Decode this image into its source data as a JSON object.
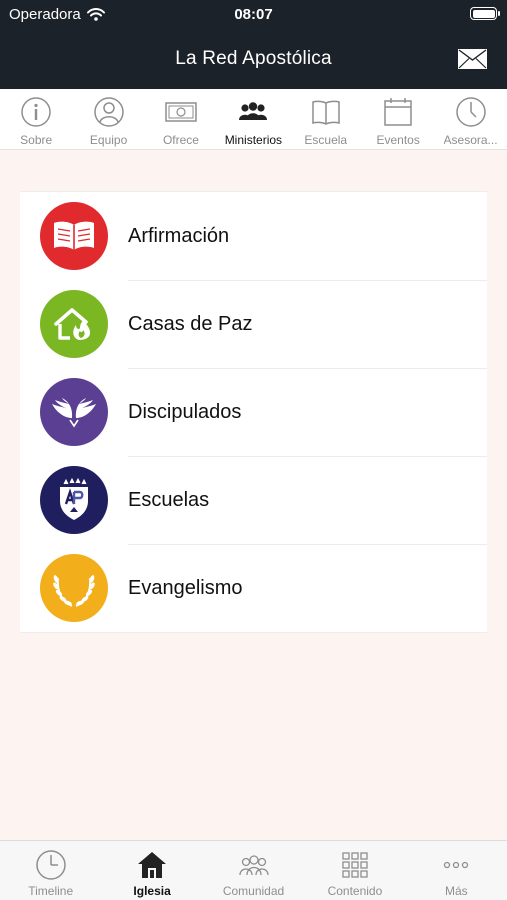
{
  "status_bar": {
    "carrier": "Operadora",
    "time": "08:07"
  },
  "header": {
    "title": "La Red Apostólica"
  },
  "top_tabs": [
    {
      "label": "Sobre",
      "icon": "info-icon"
    },
    {
      "label": "Equipo",
      "icon": "person-icon"
    },
    {
      "label": "Ofrece",
      "icon": "money-icon"
    },
    {
      "label": "Ministerios",
      "icon": "group-icon",
      "active": true
    },
    {
      "label": "Escuela",
      "icon": "book-icon"
    },
    {
      "label": "Eventos",
      "icon": "calendar-icon"
    },
    {
      "label": "Asesora...",
      "icon": "clock-icon"
    }
  ],
  "ministries": [
    {
      "label": "Arfirmación",
      "icon": "open-book-icon",
      "color": "#e12a2e"
    },
    {
      "label": "Casas de Paz",
      "icon": "house-flame-icon",
      "color": "#7bb623"
    },
    {
      "label": "Discipulados",
      "icon": "wings-icon",
      "color": "#5b3f92"
    },
    {
      "label": "Escuelas",
      "icon": "shield-crest-icon",
      "color": "#1f1f5f"
    },
    {
      "label": "Evangelismo",
      "icon": "wheat-wreath-icon",
      "color": "#f3ae1b"
    }
  ],
  "bottom_tabs": [
    {
      "label": "Timeline",
      "icon": "clock-icon"
    },
    {
      "label": "Iglesia",
      "icon": "church-icon",
      "active": true
    },
    {
      "label": "Comunidad",
      "icon": "community-icon"
    },
    {
      "label": "Contenido",
      "icon": "grid-icon"
    },
    {
      "label": "Más",
      "icon": "more-icon"
    }
  ]
}
